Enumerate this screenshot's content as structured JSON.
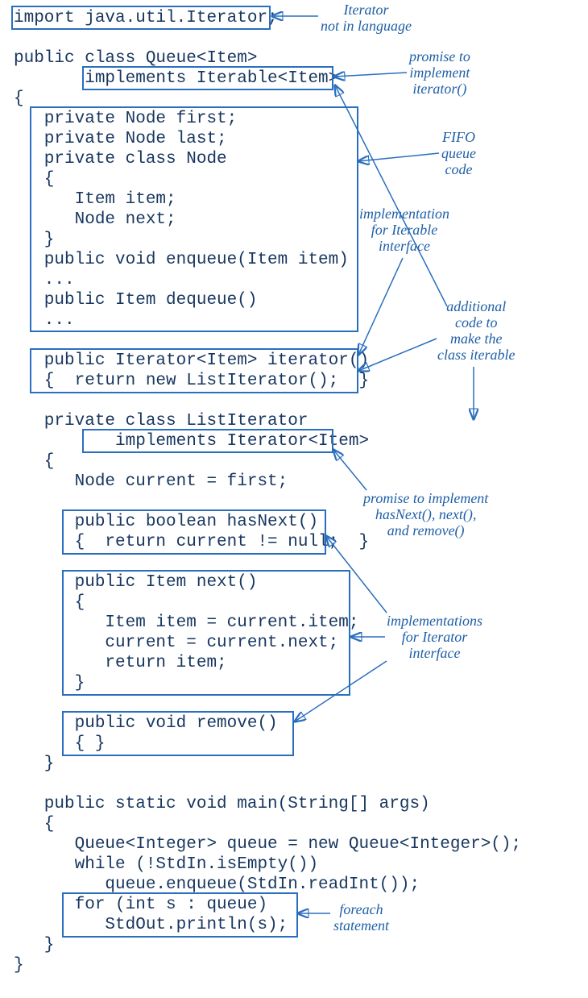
{
  "code": {
    "l1": "import java.util.Iterator;",
    "l2": "",
    "l3": "public class Queue<Item>",
    "l4": "       implements Iterable<Item>",
    "l5": "{",
    "l6": "   private Node first;",
    "l7": "   private Node last;",
    "l8": "   private class Node",
    "l9": "   {",
    "l10": "      Item item;",
    "l11": "      Node next;",
    "l12": "   }",
    "l13": "   public void enqueue(Item item)",
    "l14": "   ...",
    "l15": "   public Item dequeue()",
    "l16": "   ...",
    "l17": "",
    "l18": "   public Iterator<Item> iterator()",
    "l19": "   {  return new ListIterator();  }",
    "l20": "",
    "l21": "   private class ListIterator",
    "l22": "          implements Iterator<Item>",
    "l23": "   {",
    "l24": "      Node current = first;",
    "l25": "",
    "l26": "      public boolean hasNext()",
    "l27": "      {  return current != null;  }",
    "l28": "",
    "l29": "      public Item next()",
    "l30": "      {",
    "l31": "         Item item = current.item;",
    "l32": "         current = current.next;",
    "l33": "         return item;",
    "l34": "      }",
    "l35": "",
    "l36": "      public void remove()",
    "l37": "      { }",
    "l38": "   }",
    "l39": "",
    "l40": "   public static void main(String[] args)",
    "l41": "   {",
    "l42": "      Queue<Integer> queue = new Queue<Integer>();",
    "l43": "      while (!StdIn.isEmpty())",
    "l44": "         queue.enqueue(StdIn.readInt());",
    "l45": "      for (int s : queue)",
    "l46": "         StdOut.println(s);",
    "l47": "   }",
    "l48": "}"
  },
  "notes": {
    "iterator_notlang": "Iterator\nnot in language",
    "promise_iterator": "promise to\nimplement\niterator()",
    "fifo_queue": "FIFO\nqueue\ncode",
    "impl_iterable": "implementation\nfor Iterable\ninterface",
    "additional": "additional\ncode to\nmake the\nclass iterable",
    "promise_hasnext": "promise to implement\nhasNext(), next(),\nand remove()",
    "impl_iterator_if": "implementations\nfor Iterator\ninterface",
    "foreach": "foreach\nstatement"
  }
}
